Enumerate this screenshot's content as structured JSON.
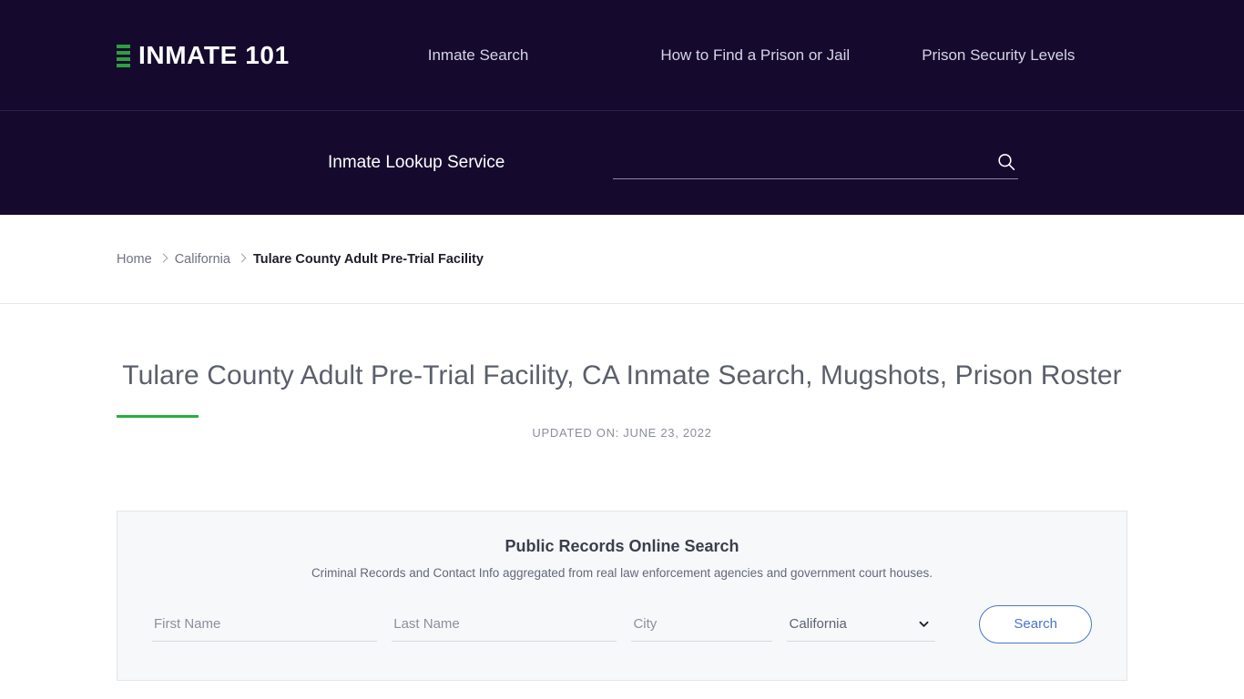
{
  "header": {
    "brand_name": "INMATE 101",
    "logo_icon": "bars-icon",
    "logo_accent_color": "#2e9e3e",
    "background_color": "#150a2e",
    "nav": [
      {
        "label": "Inmate Search"
      },
      {
        "label": "How to Find a Prison or Jail"
      },
      {
        "label": "Prison Security Levels"
      }
    ],
    "lookup": {
      "label": "Inmate Lookup Service",
      "input_value": "",
      "input_placeholder": "",
      "search_icon": "search-icon"
    }
  },
  "breadcrumb": {
    "items": [
      {
        "label": "Home",
        "current": false
      },
      {
        "label": "California",
        "current": false
      },
      {
        "label": "Tulare County Adult Pre-Trial Facility",
        "current": true
      }
    ],
    "separator_icon": "chevron-right-icon"
  },
  "main": {
    "title": "Tulare County Adult Pre-Trial Facility, CA Inmate Search, Mugshots, Prison Roster",
    "accent_color": "#27ae3f",
    "updated": "UPDATED ON: JUNE 23, 2022"
  },
  "records_card": {
    "title": "Public Records Online Search",
    "subtitle": "Criminal Records and Contact Info aggregated from real law enforcement agencies and government court houses.",
    "fields": {
      "first_name": {
        "value": "",
        "placeholder": "First Name"
      },
      "last_name": {
        "value": "",
        "placeholder": "Last Name"
      },
      "city": {
        "value": "",
        "placeholder": "City"
      },
      "state": {
        "selected": "California",
        "caret_icon": "chevron-down-icon"
      }
    },
    "search_button": {
      "label": "Search",
      "border_color": "#4a76c9",
      "text_color": "#4a76c9"
    }
  }
}
